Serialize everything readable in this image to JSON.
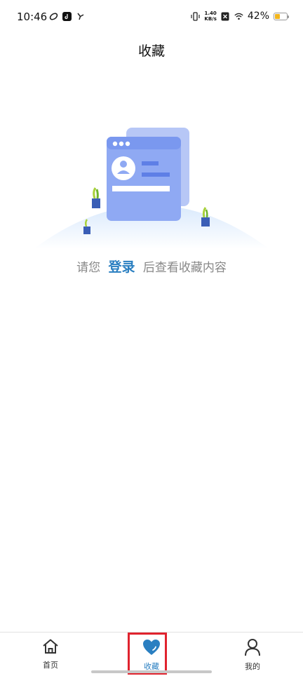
{
  "status_bar": {
    "time": "10:46",
    "net_speed_value": "1.40",
    "net_speed_unit": "KB/s",
    "battery": "42%",
    "battery_level": 0.42
  },
  "header": {
    "title": "收藏"
  },
  "empty_state": {
    "prefix": "请您",
    "login_link": "登录",
    "suffix": "后查看收藏内容"
  },
  "bottom_nav": {
    "items": [
      {
        "label": "首页",
        "icon": "home-icon"
      },
      {
        "label": "收藏",
        "icon": "heart-icon",
        "active": true
      },
      {
        "label": "我的",
        "icon": "user-icon"
      }
    ]
  },
  "colors": {
    "accent": "#2a7fc1",
    "card": "#8fa9f3",
    "highlight": "#e0232e"
  }
}
